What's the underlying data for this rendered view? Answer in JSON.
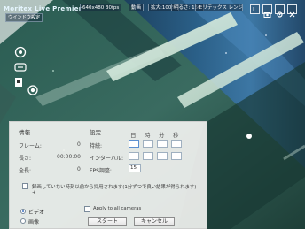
{
  "toolbar": {
    "app_title": "Moritex Live Premier",
    "resolution": "640x480 30fps",
    "mode": "動画",
    "zoom": "拡大:100%",
    "brightness": "明るさ: 150",
    "menu": "ウインドウ設定",
    "brand_truncated": "モリテックス レンジのカレ...",
    "right_icons": [
      "L",
      "snapshot-icon",
      "settings-icon",
      "close-icon"
    ]
  },
  "dialog": {
    "info_title": "情報",
    "settings_title": "設定",
    "time_headers": [
      "日",
      "時",
      "分",
      "秒"
    ],
    "info_rows": [
      {
        "label": "フレーム:",
        "value": "0"
      },
      {
        "label": "長さ:",
        "value": "00:00:00"
      },
      {
        "label": "全長:",
        "value": "0"
      }
    ],
    "setting_rows": [
      {
        "label": "持続:"
      },
      {
        "label": "インターバル:"
      },
      {
        "label": "FPS調整:",
        "value": "15"
      }
    ],
    "warning_text": "録画していない時刻以前から採用されます(1分ずつで良い結果が得られます)",
    "warning_continued": "+",
    "source_options": [
      {
        "label": "ビデオ",
        "selected": true
      },
      {
        "label": "画像",
        "selected": false
      }
    ],
    "apply_all_cameras": "Apply to all cameras",
    "start_button": "スタート",
    "cancel_button": "キャンセル"
  }
}
